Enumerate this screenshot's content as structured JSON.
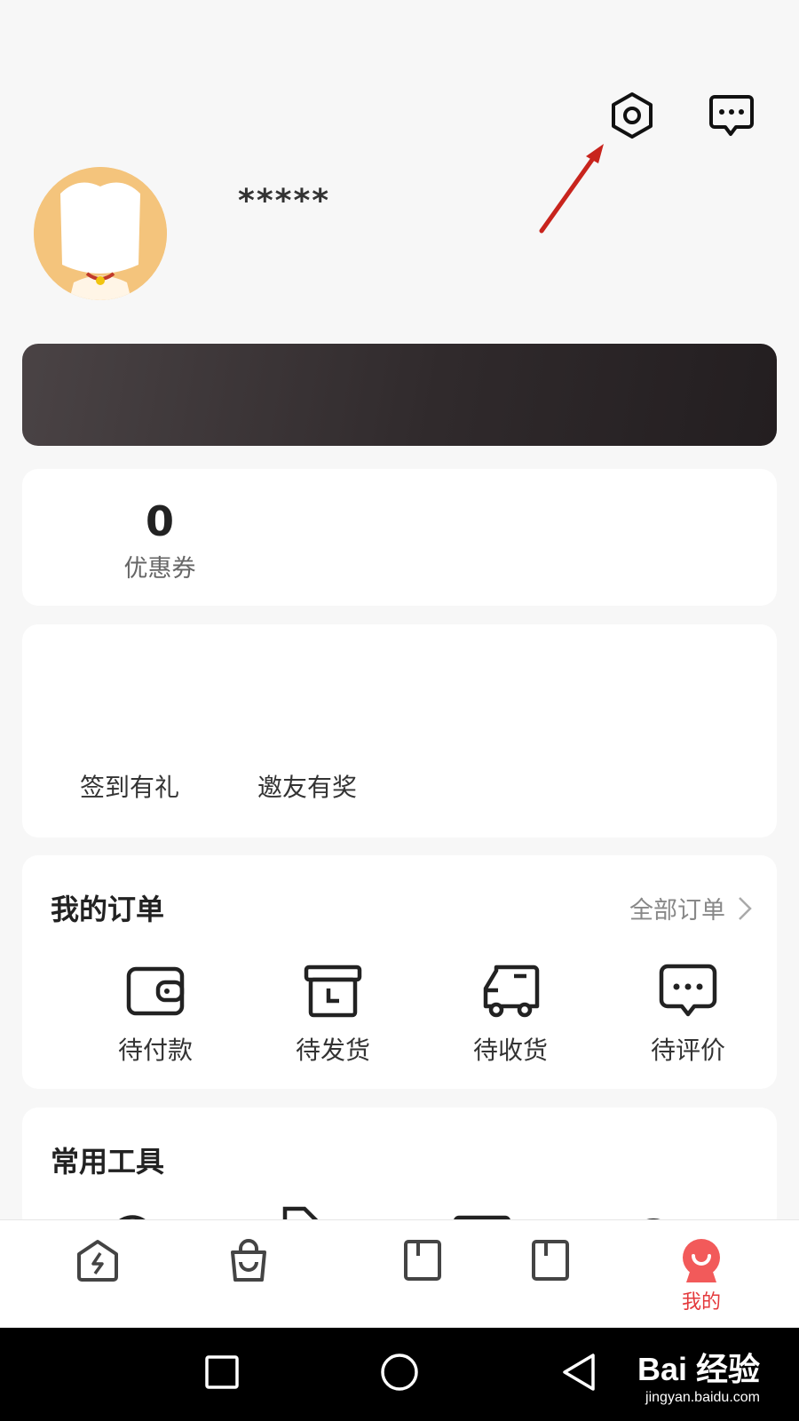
{
  "header": {
    "settings_icon": "settings-hex-icon",
    "message_icon": "message-dots-icon"
  },
  "profile": {
    "username": "*****"
  },
  "coupon": {
    "count": "0",
    "label": "优惠券"
  },
  "promo": {
    "items": [
      {
        "label": "签到有礼"
      },
      {
        "label": "邀友有奖"
      }
    ]
  },
  "orders": {
    "title": "我的订单",
    "all_label": "全部订单",
    "items": [
      {
        "label": "待付款",
        "icon": "wallet-icon"
      },
      {
        "label": "待发货",
        "icon": "box-icon"
      },
      {
        "label": "待收货",
        "icon": "truck-icon"
      },
      {
        "label": "待评价",
        "icon": "comment-icon"
      }
    ]
  },
  "tools": {
    "title": "常用工具"
  },
  "tabbar": {
    "items": [
      {
        "label": "",
        "icon": "flash-house-icon"
      },
      {
        "label": "",
        "icon": "shopping-bag-icon"
      },
      {
        "label": "",
        "icon": "bookmark-icon"
      },
      {
        "label": "",
        "icon": "bookmark-icon"
      },
      {
        "label": "我的",
        "icon": "profile-face-icon"
      }
    ],
    "active_color": "#e4393c"
  },
  "watermark": {
    "main": "Bai  经验",
    "sub": "jingyan.baidu.com"
  }
}
